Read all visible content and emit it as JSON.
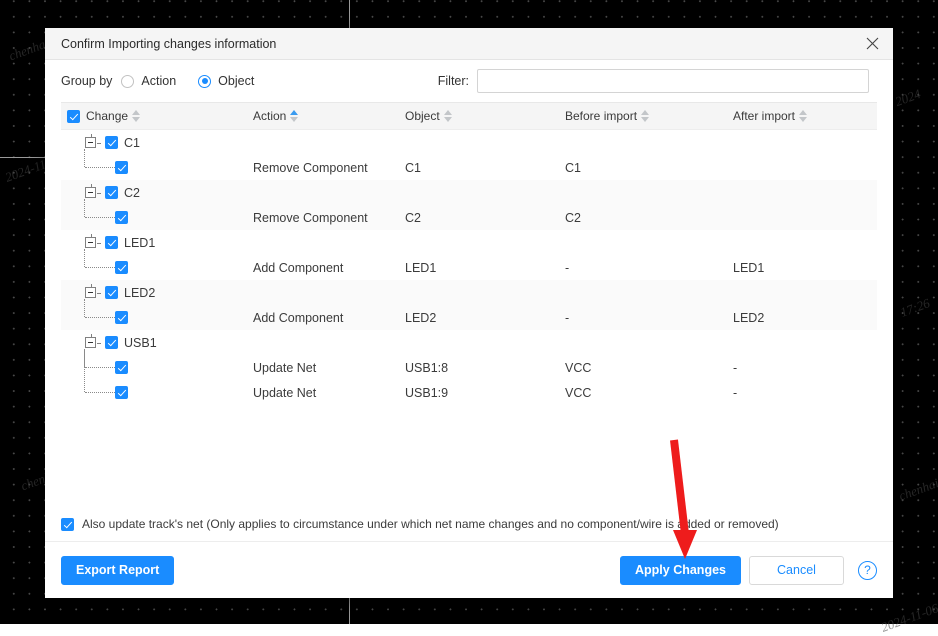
{
  "background": {
    "type": "pcb-editor-canvas",
    "bg_color": "#000000",
    "grid_dot_color": "#4a4a4a",
    "axis_color": "#9a9a9a",
    "watermarks": [
      "chenhaiqi",
      "2024-11-06",
      "17:26"
    ]
  },
  "dialog": {
    "title": "Confirm Importing changes information",
    "close_icon": "close-icon",
    "toolbar": {
      "group_by_label": "Group by",
      "options": [
        {
          "label": "Action",
          "selected": false
        },
        {
          "label": "Object",
          "selected": true
        }
      ],
      "filter_label": "Filter:",
      "filter_value": "",
      "filter_placeholder": ""
    },
    "table": {
      "header_checkbox_checked": true,
      "columns": [
        {
          "label": "Change",
          "sortable": true,
          "sort_active": false
        },
        {
          "label": "Action",
          "sortable": true,
          "sort_active": true
        },
        {
          "label": "Object",
          "sortable": true,
          "sort_active": false
        },
        {
          "label": "Before import",
          "sortable": true,
          "sort_active": false
        },
        {
          "label": "After import",
          "sortable": true,
          "sort_active": false
        }
      ],
      "groups": [
        {
          "name": "C1",
          "checked": true,
          "expanded": true,
          "children": [
            {
              "checked": true,
              "action": "Remove Component",
              "object": "C1",
              "before": "C1",
              "after": ""
            }
          ]
        },
        {
          "name": "C2",
          "checked": true,
          "expanded": true,
          "children": [
            {
              "checked": true,
              "action": "Remove Component",
              "object": "C2",
              "before": "C2",
              "after": ""
            }
          ]
        },
        {
          "name": "LED1",
          "checked": true,
          "expanded": true,
          "children": [
            {
              "checked": true,
              "action": "Add Component",
              "object": "LED1",
              "before": "-",
              "after": "LED1"
            }
          ]
        },
        {
          "name": "LED2",
          "checked": true,
          "expanded": true,
          "children": [
            {
              "checked": true,
              "action": "Add Component",
              "object": "LED2",
              "before": "-",
              "after": "LED2"
            }
          ]
        },
        {
          "name": "USB1",
          "checked": true,
          "expanded": true,
          "children": [
            {
              "checked": true,
              "action": "Update Net",
              "object": "USB1:8",
              "before": "VCC",
              "after": "-"
            },
            {
              "checked": true,
              "action": "Update Net",
              "object": "USB1:9",
              "before": "VCC",
              "after": "-"
            }
          ]
        }
      ]
    },
    "footer": {
      "note_checked": true,
      "note_label": "Also update track's net (Only applies to circumstance under which net name changes and no component/wire is added or removed)",
      "export_report_label": "Export Report",
      "apply_changes_label": "Apply Changes",
      "cancel_label": "Cancel",
      "help_label": "?"
    }
  },
  "annotation": {
    "arrow_color": "#ee1c1c",
    "points_to": "apply-changes-button"
  },
  "colors": {
    "accent": "#1a8cff",
    "titlebar": "#f5f5f5",
    "stripe": "#fafafa",
    "text": "#3b3b3b",
    "arrow_red": "#ee1c1c"
  }
}
